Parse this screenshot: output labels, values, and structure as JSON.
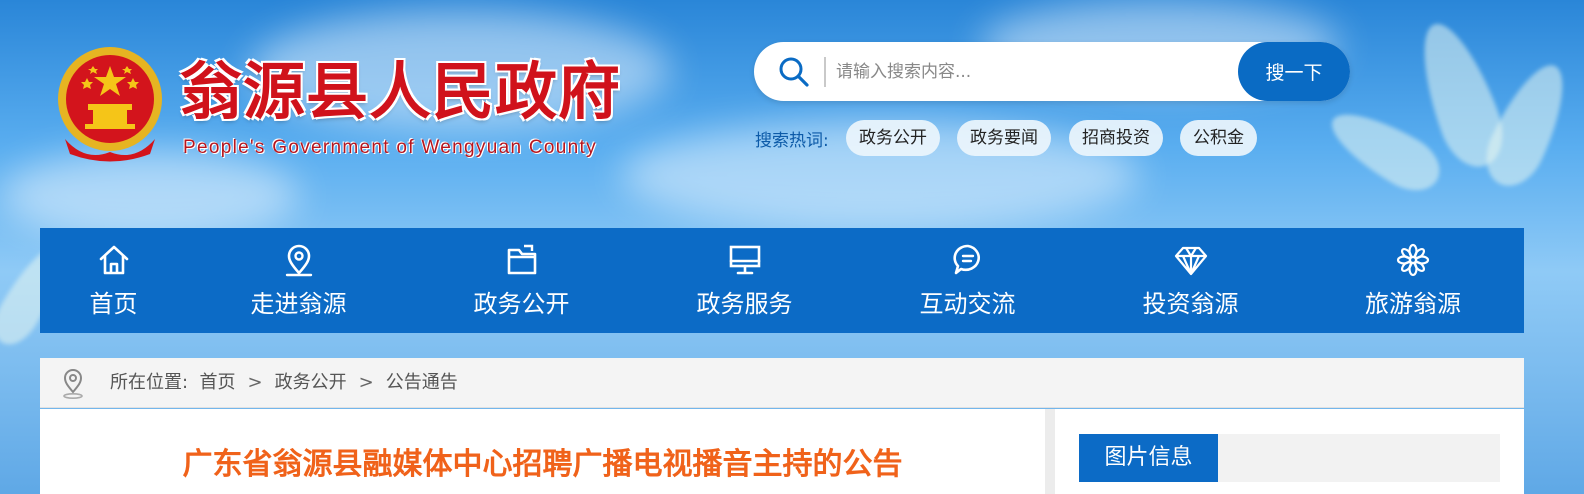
{
  "header": {
    "title": "翁源县人民政府",
    "subtitle": "People's Government of Wengyuan County",
    "emblem_icon": "national-emblem-icon"
  },
  "search": {
    "placeholder": "请输入搜索内容...",
    "button_label": "搜一下",
    "hot_label": "搜索热词:",
    "hot_tags": [
      "政务公开",
      "政务要闻",
      "招商投资",
      "公积金"
    ]
  },
  "nav": {
    "items": [
      {
        "label": "首页",
        "icon": "home-icon"
      },
      {
        "label": "走进翁源",
        "icon": "location-pin-icon"
      },
      {
        "label": "政务公开",
        "icon": "folder-icon"
      },
      {
        "label": "政务服务",
        "icon": "monitor-icon"
      },
      {
        "label": "互动交流",
        "icon": "chat-bubble-icon"
      },
      {
        "label": "投资翁源",
        "icon": "diamond-icon"
      },
      {
        "label": "旅游翁源",
        "icon": "flower-icon"
      }
    ]
  },
  "breadcrumb": {
    "prefix": "所在位置:",
    "items": [
      "首页",
      "政务公开",
      "公告通告"
    ],
    "separator": ">"
  },
  "article": {
    "title": "广东省翁源县融媒体中心招聘广播电视播音主持的公告"
  },
  "sidebar": {
    "tab_label": "图片信息"
  },
  "colors": {
    "brand_blue": "#0c6bc6",
    "title_red": "#d0121b",
    "article_orange": "#f0621a"
  }
}
